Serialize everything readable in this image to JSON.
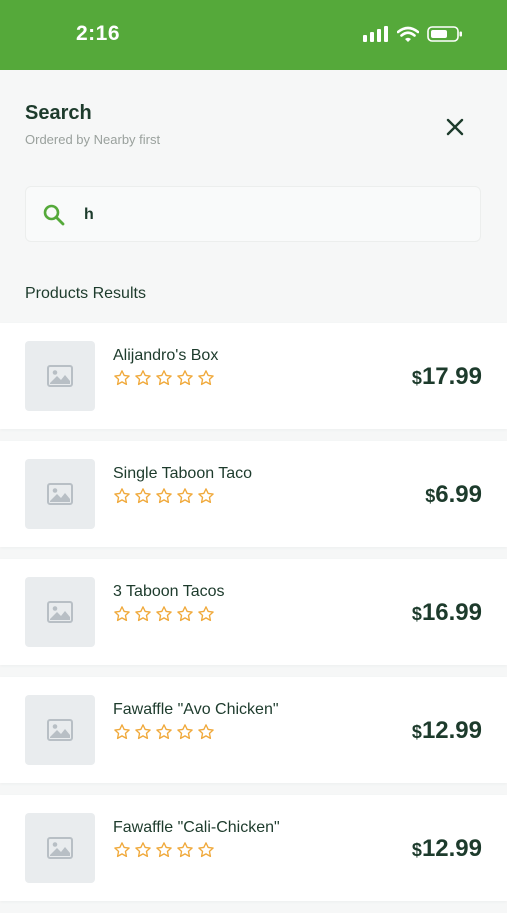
{
  "status_bar": {
    "time": "2:16"
  },
  "header": {
    "title": "Search",
    "subtitle": "Ordered by Nearby first"
  },
  "search": {
    "value": "h"
  },
  "section": {
    "title": "Products Results"
  },
  "currency_symbol": "$",
  "products": [
    {
      "name": "Alijandro's Box",
      "price": "17.99",
      "rating": 0
    },
    {
      "name": "Single Taboon Taco",
      "price": "6.99",
      "rating": 0
    },
    {
      "name": "3 Taboon Tacos",
      "price": "16.99",
      "rating": 0
    },
    {
      "name": "Fawaffle \"Avo Chicken\"",
      "price": "12.99",
      "rating": 0
    },
    {
      "name": "Fawaffle \"Cali-Chicken\"",
      "price": "12.99",
      "rating": 0
    }
  ],
  "colors": {
    "brand_green": "#55a93a",
    "star": "#f0a93b",
    "text": "#1d3b2c"
  }
}
